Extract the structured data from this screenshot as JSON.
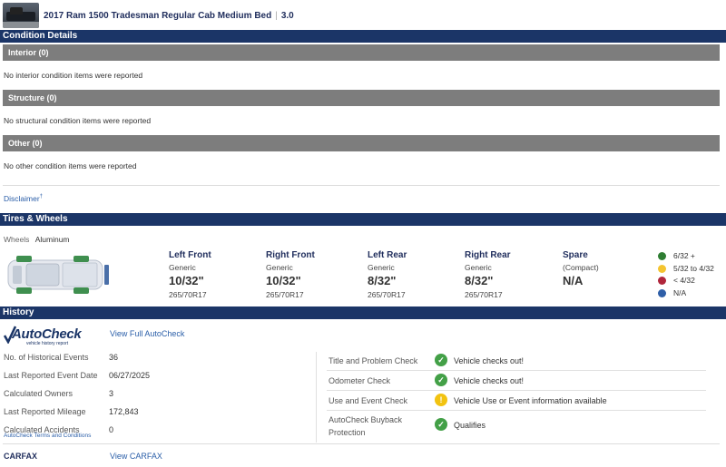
{
  "vehicle": {
    "title": "2017 Ram 1500 Tradesman Regular Cab Medium Bed",
    "grade": "3.0"
  },
  "condition": {
    "header": "Condition Details",
    "sections": [
      {
        "title": "Interior (0)",
        "message": "No interior condition items were reported"
      },
      {
        "title": "Structure (0)",
        "message": "No structural condition items were reported"
      },
      {
        "title": "Other (0)",
        "message": "No other condition items were reported"
      }
    ],
    "disclaimer": "Disclaimer",
    "disclaimer_mark": "†"
  },
  "tires": {
    "header": "Tires & Wheels",
    "wheels_label": "Wheels",
    "wheels_value": "Aluminum",
    "items": [
      {
        "name": "Left Front",
        "brand": "Generic",
        "depth": "10/32\"",
        "size": "265/70R17"
      },
      {
        "name": "Right Front",
        "brand": "Generic",
        "depth": "10/32\"",
        "size": "265/70R17"
      },
      {
        "name": "Left Rear",
        "brand": "Generic",
        "depth": "8/32\"",
        "size": "265/70R17"
      },
      {
        "name": "Right Rear",
        "brand": "Generic",
        "depth": "8/32\"",
        "size": "265/70R17"
      },
      {
        "name": "Spare",
        "brand": "(Compact)",
        "depth": "N/A",
        "size": ""
      }
    ],
    "legend": [
      {
        "label": "6/32 +",
        "color": "#2e7d32"
      },
      {
        "label": "5/32 to 4/32",
        "color": "#f4c430"
      },
      {
        "label": "< 4/32",
        "color": "#b0263c"
      },
      {
        "label": "N/A",
        "color": "#2f5fa8"
      }
    ]
  },
  "history": {
    "header": "History",
    "autocheck_logo": "AutoCheck",
    "autocheck_tagline": "vehicle history report",
    "view_autocheck": "View Full AutoCheck",
    "terms": "AutoCheck Terms and Conditions",
    "stats": [
      {
        "label": "No. of Historical Events",
        "value": "36"
      },
      {
        "label": "Last Reported Event Date",
        "value": "06/27/2025"
      },
      {
        "label": "Calculated Owners",
        "value": "3"
      },
      {
        "label": "Last Reported Mileage",
        "value": "172,843"
      },
      {
        "label": "Calculated Accidents",
        "value": "0"
      }
    ],
    "checks": [
      {
        "label": "Title and Problem Check",
        "status": "ok",
        "icon": "check-circle-icon",
        "value": "Vehicle checks out!"
      },
      {
        "label": "Odometer Check",
        "status": "ok",
        "icon": "check-circle-icon",
        "value": "Vehicle checks out!"
      },
      {
        "label": "Use and Event Check",
        "status": "warn",
        "icon": "exclamation-circle-icon",
        "value": "Vehicle Use or Event information available"
      },
      {
        "label": "AutoCheck Buyback",
        "label2": "Protection",
        "status": "ok",
        "icon": "check-circle-icon",
        "value": "Qualifies"
      }
    ],
    "carfax_label": "CARFAX",
    "view_carfax": "View CARFAX",
    "colors": {
      "ok": "#43a047",
      "warn": "#f2c311"
    }
  },
  "colors": {
    "brand_navy": "#1b3567",
    "section_grey": "#7d7d7d",
    "link": "#2a5ea8"
  }
}
